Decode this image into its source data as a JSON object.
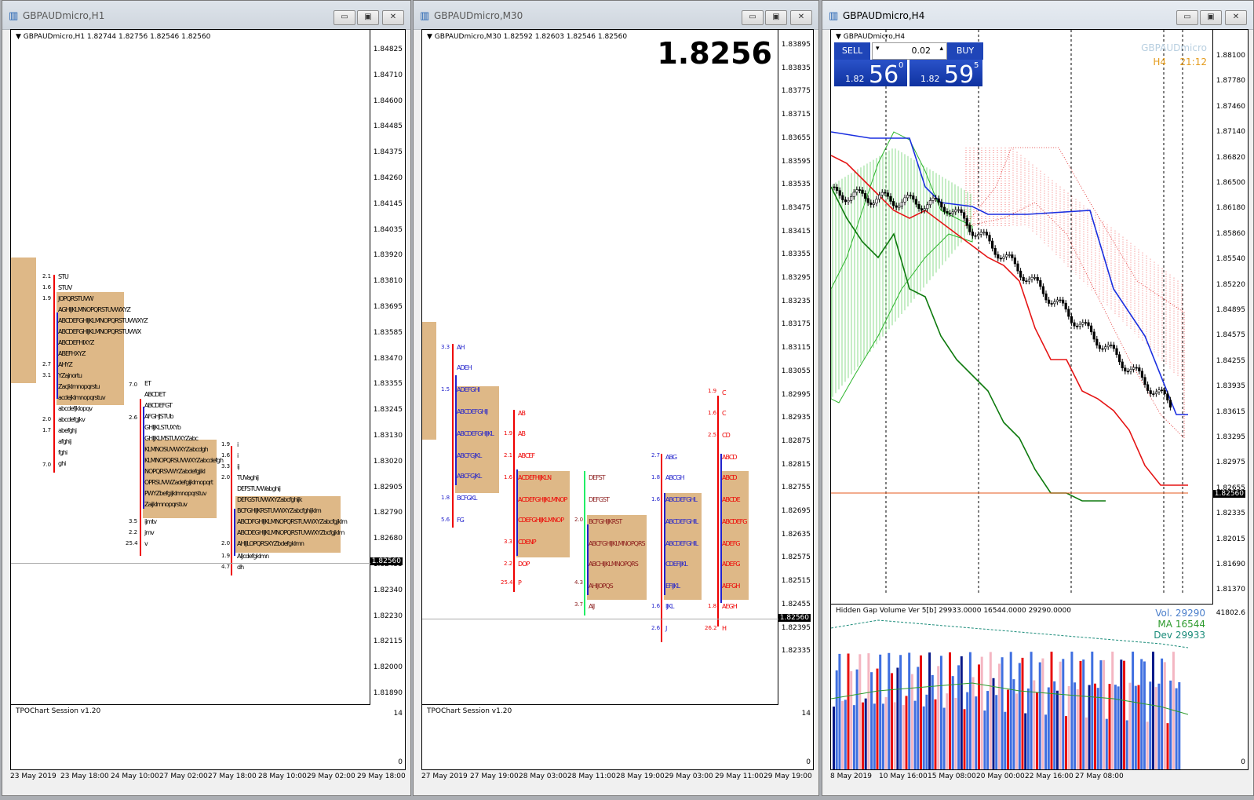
{
  "windows": [
    {
      "title": "GBPAUDmicro,H1",
      "header": "GBPAUDmicro,H1  1.82744 1.82756 1.82546 1.82560",
      "price_ticks": [
        "1.84825",
        "1.84710",
        "1.84600",
        "1.84485",
        "1.84375",
        "1.84260",
        "1.84145",
        "1.84035",
        "1.83920",
        "1.83810",
        "1.83695",
        "1.83585",
        "1.83470",
        "1.83355",
        "1.83245",
        "1.83130",
        "1.83020",
        "1.82905",
        "1.82790",
        "1.82680",
        "1.82455",
        "1.82340",
        "1.82230",
        "1.82115",
        "1.82000",
        "1.81890"
      ],
      "current_price": "1.82560",
      "sub_title": "TPOChart Session v1.20",
      "sub_ticks": [
        "14",
        "0"
      ],
      "time_labels": [
        "23 May 2019",
        "23 May 18:00",
        "24 May 10:00",
        "27 May 02:00",
        "27 May 18:00",
        "28 May 10:00",
        "29 May 02:00",
        "29 May 18:00"
      ]
    },
    {
      "title": "GBPAUDmicro,M30",
      "header": "GBPAUDmicro,M30  1.82592 1.82603 1.82546 1.82560",
      "big_price": "1.8256",
      "price_ticks": [
        "1.83895",
        "1.83835",
        "1.83775",
        "1.83715",
        "1.83655",
        "1.83595",
        "1.83535",
        "1.83475",
        "1.83415",
        "1.83355",
        "1.83295",
        "1.83235",
        "1.83175",
        "1.83115",
        "1.83055",
        "1.82995",
        "1.82935",
        "1.82875",
        "1.82815",
        "1.82755",
        "1.82695",
        "1.82635",
        "1.82575",
        "1.82515",
        "1.82455",
        "1.82395",
        "1.82335"
      ],
      "current_price": "1.82560",
      "sub_title": "TPOChart Session v1.20",
      "sub_ticks": [
        "14",
        "0"
      ],
      "time_labels": [
        "27 May 2019",
        "27 May 19:00",
        "28 May 03:00",
        "28 May 11:00",
        "28 May 19:00",
        "29 May 03:00",
        "29 May 11:00",
        "29 May 19:00"
      ]
    },
    {
      "title": "GBPAUDmicro,H4",
      "header": "GBPAUDmicro,H4",
      "symbol_watermark": "GBPAUDmicro",
      "timeframe": "H4",
      "countdown": "21:12",
      "trade": {
        "sell_label": "SELL",
        "buy_label": "BUY",
        "lot": "0.02",
        "sell_prefix": "1.82",
        "sell_big": "56",
        "sell_sup": "0",
        "buy_prefix": "1.82",
        "buy_big": "59",
        "buy_sup": "5"
      },
      "price_ticks": [
        "1.88100",
        "1.87780",
        "1.87460",
        "1.87140",
        "1.86820",
        "1.86500",
        "1.86180",
        "1.85860",
        "1.85540",
        "1.85220",
        "1.84895",
        "1.84575",
        "1.84255",
        "1.83935",
        "1.83615",
        "1.83295",
        "1.82975",
        "1.82655",
        "1.82335",
        "1.82015",
        "1.81690",
        "1.81370"
      ],
      "current_price": "1.82560",
      "sub_title": "Hidden Gap Volume Ver 5[b] 29933.0000 16544.0000 29290.0000",
      "sub_ticks": [
        "41802.6",
        "0"
      ],
      "vol_label": "Vol.",
      "vol_value": "29290",
      "ma_label": "MA",
      "ma_value": "16544",
      "dev_label": "Dev",
      "dev_value": "29933",
      "time_labels": [
        "8 May 2019",
        "10 May 16:00",
        "15 May 08:00",
        "20 May 00:00",
        "22 May 16:00",
        "27 May 08:00"
      ]
    }
  ]
}
